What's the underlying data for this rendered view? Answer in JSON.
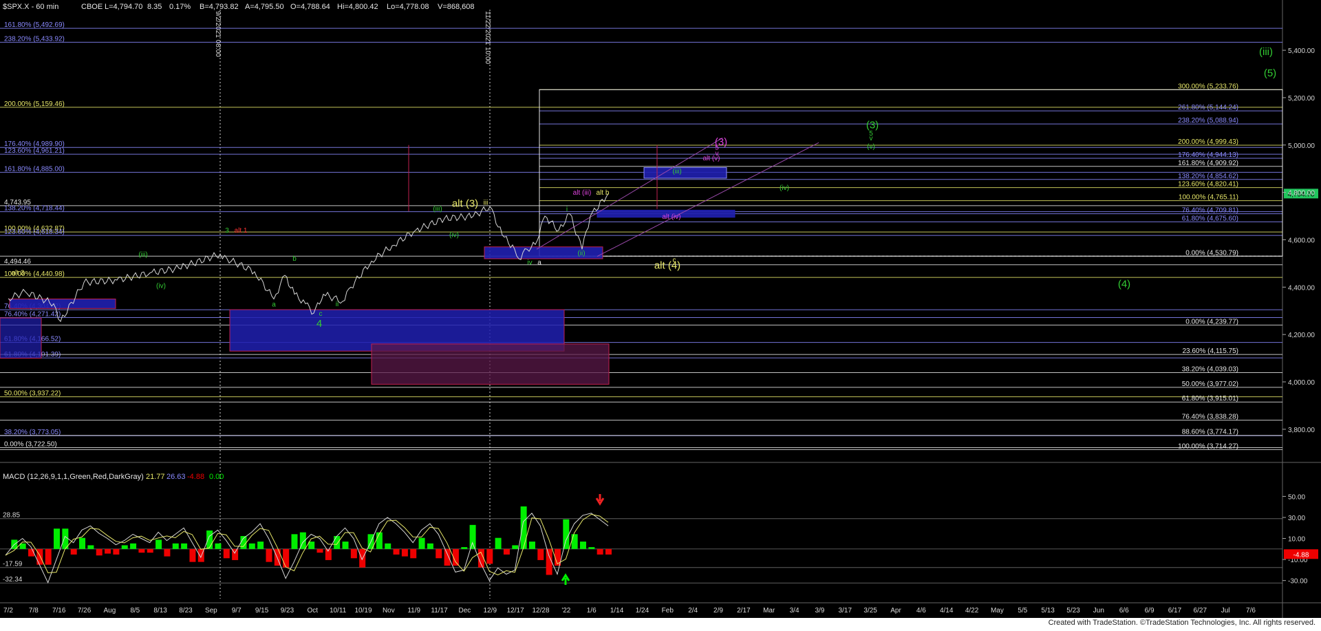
{
  "header": {
    "symbol": "$SPX.X - 60 min",
    "exchange": "CBOE",
    "last": "L=4,794.70",
    "change": "8.35",
    "change_pct": "0.17%",
    "bid": "B=4,793.82",
    "ask": "A=4,795.50",
    "open": "O=4,788.64",
    "high": "Hi=4,800.42",
    "low": "Lo=4,778.08",
    "volume": "V=868,608"
  },
  "macd_header": {
    "title": "MACD (12,26,9,1,1,Green,Red,DarkGray)",
    "v1": "21.77",
    "v2": "26.63",
    "v3": "-4.88",
    "v4": "0.00"
  },
  "footer": "Created with TradeStation. ©TradeStation Technologies, Inc. All rights reserved.",
  "colors": {
    "background": "#000000",
    "price": "#d8d8d8",
    "wave_green": "#33cc33",
    "wave_yellow": "#f0f000",
    "wave_magenta": "#dd44dd",
    "fib_blue": "#8a8aff",
    "fib_yellow": "#e8e86a",
    "fib_white": "#e6e6e6",
    "box_blue": "#2020b0",
    "box_red": "#c02050",
    "macd_green": "#00ee00",
    "macd_red": "#ee0000",
    "last_price_tag": "#22c55e"
  },
  "chart_data": {
    "type": "line",
    "title": "$SPX.X - 60 min",
    "xlabel": "",
    "ylabel": "",
    "ylim": [
      3660,
      5560
    ],
    "grid": false,
    "y_ticks": [
      5400,
      5200,
      5000,
      4800,
      4600,
      4400,
      4200,
      4000,
      3800
    ],
    "y_tick_labels": [
      "5,400.00",
      "5,200.00",
      "5,000.00",
      "4,800.00",
      "4,600.00",
      "4,400.00",
      "4,200.00",
      "4,000.00",
      "3,800.00"
    ],
    "x_tick_labels": [
      "7/2",
      "7/8",
      "7/16",
      "7/26",
      "Aug",
      "8/5",
      "8/13",
      "8/23",
      "Sep",
      "9/7",
      "9/15",
      "9/23",
      "Oct",
      "10/11",
      "10/19",
      "Nov",
      "11/9",
      "11/17",
      "Dec",
      "12/9",
      "12/17",
      "12/28",
      "'22",
      "1/6",
      "1/14",
      "1/24",
      "Feb",
      "2/4",
      "2/9",
      "2/17",
      "Mar",
      "3/4",
      "3/9",
      "3/17",
      "3/25",
      "Apr",
      "4/6",
      "4/14",
      "4/22",
      "May",
      "5/5",
      "5/13",
      "5/23",
      "Jun",
      "6/6",
      "6/9",
      "6/17",
      "6/27",
      "Jul",
      "7/6"
    ],
    "last_price_label": "4,794.70",
    "series": [
      {
        "name": "$SPX.X",
        "x": [
          "7/2",
          "7/8",
          "7/16",
          "7/19",
          "7/26",
          "8/5",
          "8/13",
          "8/23",
          "9/2",
          "9/7",
          "9/15",
          "9/20",
          "9/23",
          "9/27",
          "10/1",
          "10/4",
          "10/6",
          "10/11",
          "10/13",
          "10/19",
          "10/25",
          "11/2",
          "11/9",
          "11/17",
          "11/22",
          "11/26",
          "11/30",
          "12/1",
          "12/3",
          "12/6",
          "12/9",
          "12/13",
          "12/16",
          "12/20",
          "12/22",
          "12/28"
        ],
        "values": [
          4352,
          4380,
          4330,
          4255,
          4420,
          4430,
          4460,
          4480,
          4540,
          4520,
          4465,
          4350,
          4450,
          4370,
          4330,
          4290,
          4370,
          4340,
          4400,
          4510,
          4575,
          4640,
          4690,
          4700,
          4740,
          4620,
          4560,
          4520,
          4560,
          4580,
          4700,
          4640,
          4710,
          4560,
          4700,
          4795
        ]
      }
    ],
    "fib_levels_left": [
      {
        "label": "161.80% (5,492.69)",
        "value": 5492.69,
        "color": "blue"
      },
      {
        "label": "238.20% (5,433.92)",
        "value": 5433.92,
        "color": "blue"
      },
      {
        "label": "200.00% (5,159.46)",
        "value": 5159.46,
        "color": "yellow"
      },
      {
        "label": "176.40% (4,989.90)",
        "value": 4989.9,
        "color": "blue"
      },
      {
        "label": "123.60% (4,961.21)",
        "value": 4961.21,
        "color": "blue"
      },
      {
        "label": "161.80% (4,885.00)",
        "value": 4885.0,
        "color": "blue"
      },
      {
        "label": "4,743.95",
        "value": 4743.95,
        "color": "white"
      },
      {
        "label": "138.20% (4,718.44)",
        "value": 4718.44,
        "color": "blue"
      },
      {
        "label": "100.00% (4,632.87)",
        "value": 4632.87,
        "color": "yellow"
      },
      {
        "label": "123.60% (4,618.34)",
        "value": 4618.34,
        "color": "blue"
      },
      {
        "label": "4,494.46",
        "value": 4494.46,
        "color": "white"
      },
      {
        "label": "100.00% (4,440.98)",
        "value": 4440.98,
        "color": "yellow"
      },
      {
        "label": "76.40% (4,304.52)",
        "value": 4304.52,
        "color": "blue"
      },
      {
        "label": "76.40% (4,271.42)",
        "value": 4271.42,
        "color": "blue"
      },
      {
        "label": "61.80% (4,166.52)",
        "value": 4166.52,
        "color": "blue"
      },
      {
        "label": "61.80% (4,101.39)",
        "value": 4101.39,
        "color": "blue"
      },
      {
        "label": "50.00% (3,937.22)",
        "value": 3937.22,
        "color": "yellow"
      },
      {
        "label": "38.20% (3,773.05)",
        "value": 3773.05,
        "color": "blue"
      },
      {
        "label": "0.00% (3,722.50)",
        "value": 3722.5,
        "color": "white"
      }
    ],
    "fib_levels_right": [
      {
        "label": "300.00% (5,233.76)",
        "value": 5233.76,
        "color": "yellow"
      },
      {
        "label": "261.80% (5,144.24)",
        "value": 5144.24,
        "color": "blue"
      },
      {
        "label": "238.20% (5,088.94)",
        "value": 5088.94,
        "color": "blue"
      },
      {
        "label": "200.00% (4,999.43)",
        "value": 4999.43,
        "color": "yellow"
      },
      {
        "label": "176.40% (4,944.13)",
        "value": 4944.13,
        "color": "blue"
      },
      {
        "label": "161.80% (4,909.92)",
        "value": 4909.92,
        "color": "white"
      },
      {
        "label": "138.20% (4,854.62)",
        "value": 4854.62,
        "color": "blue"
      },
      {
        "label": "123.60% (4,820.41)",
        "value": 4820.41,
        "color": "yellow"
      },
      {
        "label": "100.00% (4,765.11)",
        "value": 4765.11,
        "color": "yellow"
      },
      {
        "label": "76.40% (4,709.81)",
        "value": 4709.81,
        "color": "blue"
      },
      {
        "label": "61.80% (4,675.60)",
        "value": 4675.6,
        "color": "blue"
      },
      {
        "label": "0.00% (4,530.79)",
        "value": 4530.79,
        "color": "white"
      },
      {
        "label": "0.00% (4,239.77)",
        "value": 4239.77,
        "color": "white"
      },
      {
        "label": "23.60% (4,115.75)",
        "value": 4115.75,
        "color": "white"
      },
      {
        "label": "38.20% (4,039.03)",
        "value": 4039.03,
        "color": "white"
      },
      {
        "label": "50.00% (3,977.02)",
        "value": 3977.02,
        "color": "white"
      },
      {
        "label": "61.80% (3,915.01)",
        "value": 3915.01,
        "color": "white"
      },
      {
        "label": "76.40% (3,838.28)",
        "value": 3838.28,
        "color": "white"
      },
      {
        "label": "88.60% (3,774.17)",
        "value": 3774.17,
        "color": "white"
      },
      {
        "label": "100.00% (3,714.27)",
        "value": 3714.27,
        "color": "white"
      }
    ],
    "vertical_markers": [
      {
        "label": "9/2/2021 08:00",
        "x": "9/2"
      },
      {
        "label": "11/22/2021 10:00",
        "x": "11/22"
      }
    ],
    "wave_labels": [
      {
        "text": "(iii)",
        "color": "green",
        "size": "large"
      },
      {
        "text": "(5)",
        "color": "green",
        "size": "large"
      },
      {
        "text": "(3)",
        "color": "green",
        "size": "large"
      },
      {
        "text": "5",
        "color": "green"
      },
      {
        "text": "v",
        "color": "green"
      },
      {
        "text": "(v)",
        "color": "green"
      },
      {
        "text": "(3)",
        "color": "magenta",
        "size": "large"
      },
      {
        "text": "5",
        "color": "magenta"
      },
      {
        "text": "v",
        "color": "magenta"
      },
      {
        "text": "alt (v)",
        "color": "magenta"
      },
      {
        "text": "(iii)",
        "color": "green"
      },
      {
        "text": "(iv)",
        "color": "green"
      },
      {
        "text": "alt (iii)",
        "color": "magenta"
      },
      {
        "text": "alt b",
        "color": "yellow"
      },
      {
        "text": "alt (iv)",
        "color": "magenta"
      },
      {
        "text": "alt (3)",
        "color": "yellow",
        "size": "large"
      },
      {
        "text": "iii",
        "color": "yellow"
      },
      {
        "text": "(iii)",
        "color": "green"
      },
      {
        "text": "(iv)",
        "color": "green"
      },
      {
        "text": "i",
        "color": "green"
      },
      {
        "text": "(ii)",
        "color": "green"
      },
      {
        "text": "iv",
        "color": "green"
      },
      {
        "text": "a",
        "color": "white"
      },
      {
        "text": "c",
        "color": "yellow"
      },
      {
        "text": "alt (4)",
        "color": "yellow",
        "size": "large"
      },
      {
        "text": "(4)",
        "color": "green",
        "size": "large"
      },
      {
        "text": "3",
        "color": "green"
      },
      {
        "text": "alt 1",
        "color": "red"
      },
      {
        "text": "(iii)",
        "color": "green"
      },
      {
        "text": "(iv)",
        "color": "green"
      },
      {
        "text": "alt 3",
        "color": "yellow"
      },
      {
        "text": "b",
        "color": "green"
      },
      {
        "text": "a",
        "color": "green"
      },
      {
        "text": "c",
        "color": "green"
      },
      {
        "text": "ii",
        "color": "green"
      },
      {
        "text": "4",
        "color": "green",
        "size": "large"
      }
    ],
    "macd": {
      "ylim": [
        -42,
        64
      ],
      "y_ticks": [
        50,
        30,
        10,
        -10,
        -30
      ],
      "y_tick_labels": [
        "50.00",
        "30.00",
        "10.00",
        "-10.00",
        "-30.00"
      ],
      "left_labels": [
        "28.85",
        "-17.59",
        "-32.34"
      ],
      "last_value_label": "-4.88",
      "values": [
        -6,
        4,
        10,
        2,
        -15,
        -32,
        -10,
        12,
        6,
        18,
        22,
        15,
        10,
        4,
        8,
        14,
        10,
        6,
        16,
        8,
        14,
        20,
        6,
        -8,
        12,
        18,
        8,
        -4,
        10,
        16,
        24,
        10,
        -8,
        -28,
        -12,
        6,
        14,
        10,
        -2,
        12,
        20,
        10,
        -10,
        6,
        24,
        30,
        24,
        16,
        6,
        18,
        24,
        14,
        -4,
        -22,
        -20,
        6,
        -14,
        -30,
        -18,
        -24,
        -20,
        26,
        34,
        22,
        -6,
        -24,
        8,
        24,
        32,
        34,
        28,
        22
      ]
    }
  }
}
